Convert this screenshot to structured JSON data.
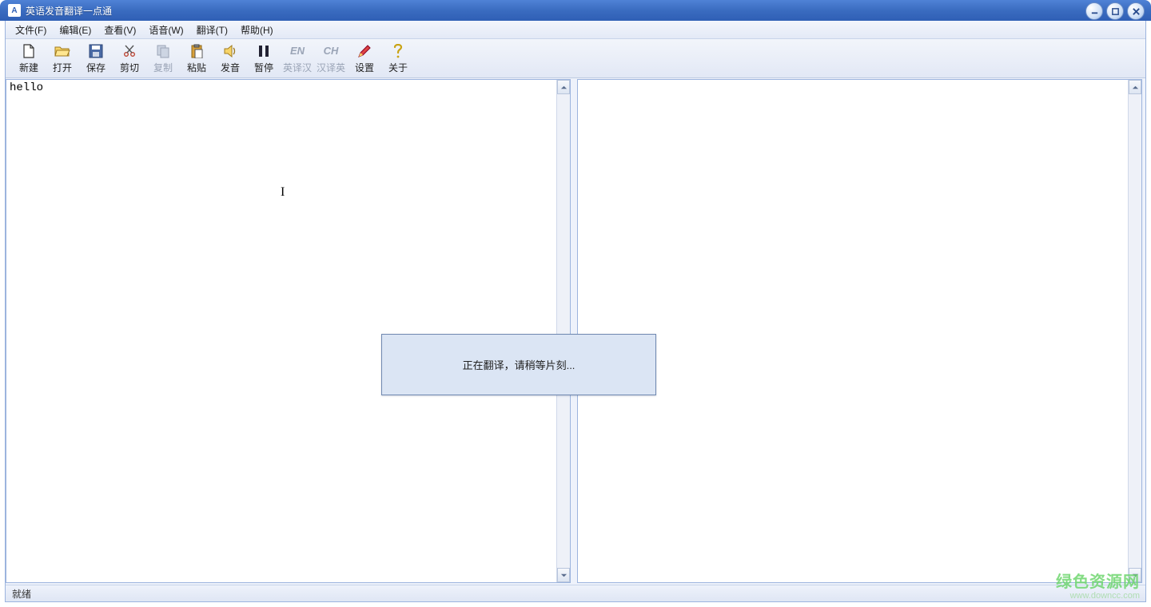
{
  "title": "英语发音翻译一点通",
  "menus": {
    "file": "文件(F)",
    "edit": "编辑(E)",
    "view": "查看(V)",
    "voice": "语音(W)",
    "trans": "翻译(T)",
    "help": "帮助(H)"
  },
  "toolbar": {
    "new": "新建",
    "open": "打开",
    "save": "保存",
    "cut": "剪切",
    "copy": "复制",
    "paste": "粘贴",
    "speak": "发音",
    "pause": "暂停",
    "en2cn": "英译汉",
    "cn2en": "汉译英",
    "settings": "设置",
    "about": "关于",
    "en_icon": "EN",
    "ch_icon": "CH"
  },
  "editor": {
    "left_text": "hello",
    "right_text": ""
  },
  "modal": {
    "message": "正在翻译，请稍等片刻..."
  },
  "status": {
    "text": "就绪"
  },
  "watermark": {
    "main": "绿色资源网",
    "sub": "www.downcc.com"
  }
}
